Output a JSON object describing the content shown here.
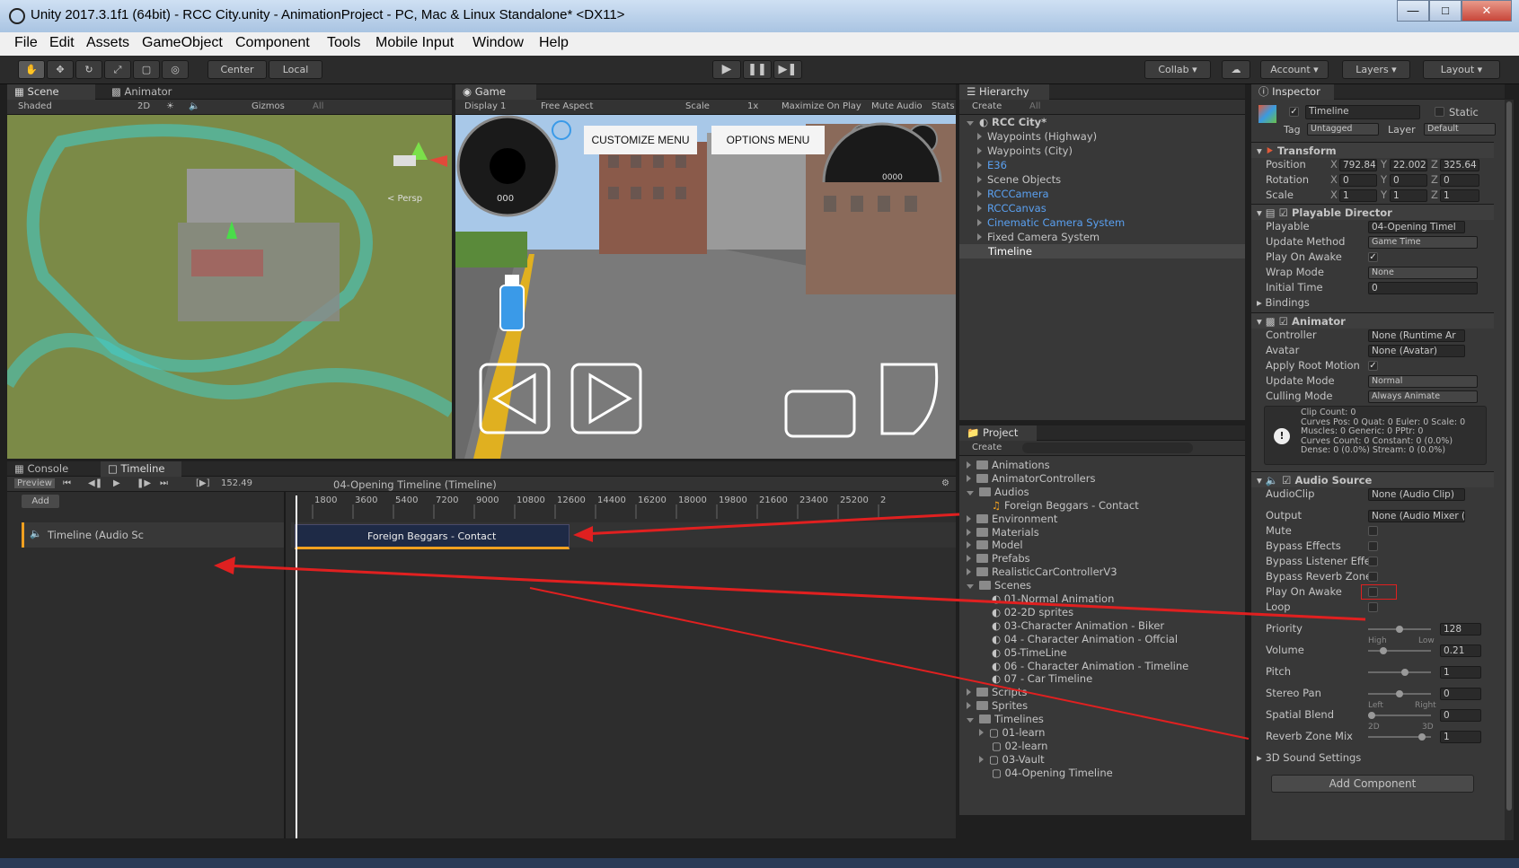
{
  "window": {
    "title": "Unity 2017.3.1f1 (64bit) - RCC City.unity - AnimationProject - PC, Mac & Linux Standalone* <DX11>"
  },
  "menu": [
    "File",
    "Edit",
    "Assets",
    "GameObject",
    "Component",
    "Tools",
    "Mobile Input",
    "Window",
    "Help"
  ],
  "toolbar": {
    "center": "Center",
    "local": "Local",
    "collab": "Collab",
    "account": "Account",
    "layers": "Layers",
    "layout": "Layout"
  },
  "scene": {
    "tab": "Scene",
    "tab2": "Animator",
    "shaded": "Shaded",
    "mode2d": "2D",
    "gizmos": "Gizmos",
    "search": "All",
    "persp": "< Persp"
  },
  "game": {
    "tab": "Game",
    "display": "Display 1",
    "aspect": "Free Aspect",
    "scale": "Scale",
    "scale_val": "1x",
    "max": "Maximize On Play",
    "mute": "Mute Audio",
    "stats": "Stats",
    "btn1": "CUSTOMIZE MENU",
    "btn2": "OPTIONS MENU",
    "speedo": "000",
    "tacho": "0000"
  },
  "hierarchy": {
    "tab": "Hierarchy",
    "create": "Create",
    "search": "All",
    "root": "RCC City*",
    "items": [
      {
        "label": "Waypoints (Highway)",
        "blue": false
      },
      {
        "label": "Waypoints (City)",
        "blue": false
      },
      {
        "label": "E36",
        "blue": true
      },
      {
        "label": "Scene Objects",
        "blue": false
      },
      {
        "label": "RCCCamera",
        "blue": true
      },
      {
        "label": "RCCCanvas",
        "blue": true
      },
      {
        "label": "Cinematic Camera System",
        "blue": true
      },
      {
        "label": "Fixed Camera System",
        "blue": false
      }
    ],
    "selected": "Timeline"
  },
  "project": {
    "tab": "Project",
    "create": "Create",
    "items": [
      {
        "label": "Animations",
        "type": "folder",
        "indent": 0,
        "arrow": "r"
      },
      {
        "label": "AnimatorControllers",
        "type": "folder",
        "indent": 0,
        "arrow": "r"
      },
      {
        "label": "Audios",
        "type": "folder",
        "indent": 0,
        "arrow": "d"
      },
      {
        "label": "Foreign Beggars - Contact",
        "type": "audio",
        "indent": 1,
        "arrow": ""
      },
      {
        "label": "Environment",
        "type": "folder",
        "indent": 0,
        "arrow": "r"
      },
      {
        "label": "Materials",
        "type": "folder",
        "indent": 0,
        "arrow": "r"
      },
      {
        "label": "Model",
        "type": "folder",
        "indent": 0,
        "arrow": "r"
      },
      {
        "label": "Prefabs",
        "type": "folder",
        "indent": 0,
        "arrow": "r"
      },
      {
        "label": "RealisticCarControllerV3",
        "type": "folder",
        "indent": 0,
        "arrow": "r"
      },
      {
        "label": "Scenes",
        "type": "folder",
        "indent": 0,
        "arrow": "d"
      },
      {
        "label": "01-Normal Animation",
        "type": "unity",
        "indent": 1,
        "arrow": ""
      },
      {
        "label": "02-2D sprites",
        "type": "unity",
        "indent": 1,
        "arrow": ""
      },
      {
        "label": "03-Character Animation - Biker",
        "type": "unity",
        "indent": 1,
        "arrow": ""
      },
      {
        "label": "04 - Character Animation - Offcial",
        "type": "unity",
        "indent": 1,
        "arrow": ""
      },
      {
        "label": "05-TimeLine",
        "type": "unity",
        "indent": 1,
        "arrow": ""
      },
      {
        "label": "06 - Character Animation - Timeline",
        "type": "unity",
        "indent": 1,
        "arrow": ""
      },
      {
        "label": "07 - Car Timeline",
        "type": "unity",
        "indent": 1,
        "arrow": ""
      },
      {
        "label": "Scripts",
        "type": "folder",
        "indent": 0,
        "arrow": "r"
      },
      {
        "label": "Sprites",
        "type": "folder",
        "indent": 0,
        "arrow": "r"
      },
      {
        "label": "Timelines",
        "type": "folder",
        "indent": 0,
        "arrow": "d"
      },
      {
        "label": "01-learn",
        "type": "timeline",
        "indent": 1,
        "arrow": "r"
      },
      {
        "label": "02-learn",
        "type": "timeline",
        "indent": 1,
        "arrow": ""
      },
      {
        "label": "03-Vault",
        "type": "timeline",
        "indent": 1,
        "arrow": "r"
      },
      {
        "label": "04-Opening Timeline",
        "type": "timeline",
        "indent": 1,
        "arrow": ""
      }
    ]
  },
  "inspector": {
    "tab": "Inspector",
    "name": "Timeline",
    "static": "Static",
    "tag_label": "Tag",
    "tag": "Untagged",
    "layer_label": "Layer",
    "layer": "Default",
    "transform": {
      "title": "Transform",
      "pos_label": "Position",
      "rot_label": "Rotation",
      "scale_label": "Scale",
      "px": "792.84",
      "py": "22.002",
      "pz": "325.64",
      "rx": "0",
      "ry": "0",
      "rz": "0",
      "sx": "1",
      "sy": "1",
      "sz": "1",
      "X": "X",
      "Y": "Y",
      "Z": "Z"
    },
    "director": {
      "title": "Playable Director",
      "playable_label": "Playable",
      "playable": "04-Opening Timel",
      "update_label": "Update Method",
      "update": "Game Time",
      "awake_label": "Play On Awake",
      "wrap_label": "Wrap Mode",
      "wrap": "None",
      "init_label": "Initial Time",
      "init": "0",
      "bindings": "Bindings"
    },
    "animator": {
      "title": "Animator",
      "ctrl_label": "Controller",
      "ctrl": "None (Runtime Ar",
      "avatar_label": "Avatar",
      "avatar": "None (Avatar)",
      "root_label": "Apply Root Motion",
      "upd_label": "Update Mode",
      "upd": "Normal",
      "cull_label": "Culling Mode",
      "cull": "Always Animate",
      "info": [
        "Clip Count: 0",
        "Curves Pos: 0 Quat: 0 Euler: 0 Scale: 0",
        "Muscles: 0 Generic: 0 PPtr: 0",
        "Curves Count: 0 Constant: 0 (0.0%)",
        "Dense: 0 (0.0%) Stream: 0 (0.0%)"
      ]
    },
    "audio": {
      "title": "Audio Source",
      "clip_label": "AudioClip",
      "clip": "None (Audio Clip)",
      "out_label": "Output",
      "out": "None (Audio Mixer (",
      "mute": "Mute",
      "bypass_fx": "Bypass Effects",
      "bypass_listener": "Bypass Listener Effe",
      "bypass_reverb": "Bypass Reverb Zone",
      "awake": "Play On Awake",
      "loop": "Loop",
      "priority_label": "Priority",
      "priority": "128",
      "high": "High",
      "low": "Low",
      "volume_label": "Volume",
      "volume": "0.21",
      "pitch_label": "Pitch",
      "pitch": "1",
      "stereo_label": "Stereo Pan",
      "stereo": "0",
      "left": "Left",
      "right": "Right",
      "spatial_label": "Spatial Blend",
      "spatial": "0",
      "d2": "2D",
      "d3": "3D",
      "reverb_label": "Reverb Zone Mix",
      "reverb": "1",
      "sound3d": "3D Sound Settings",
      "priority_pos": 0.5,
      "volume_pos": 0.21,
      "pitch_pos": 0.6,
      "stereo_pos": 0.5,
      "spatial_pos": 0.0,
      "reverb_pos": 0.9
    },
    "add_component": "Add Component"
  },
  "timeline": {
    "tab1": "Console",
    "tab2": "Timeline",
    "preview": "Preview",
    "frame": "152.49",
    "asset": "04-Opening Timeline (Timeline)",
    "add": "Add",
    "track": "Timeline (Audio Sc",
    "clip": "Foreign Beggars - Contact",
    "ticks": [
      "1800",
      "3600",
      "5400",
      "7200",
      "9000",
      "10800",
      "12600",
      "14400",
      "16200",
      "18000",
      "19800",
      "21600",
      "23400",
      "25200",
      "2"
    ]
  },
  "colors": {
    "accent": "#4a90e2",
    "annotation": "#e02020",
    "selection": "#3e5f96",
    "audio_track": "#f0a020"
  }
}
